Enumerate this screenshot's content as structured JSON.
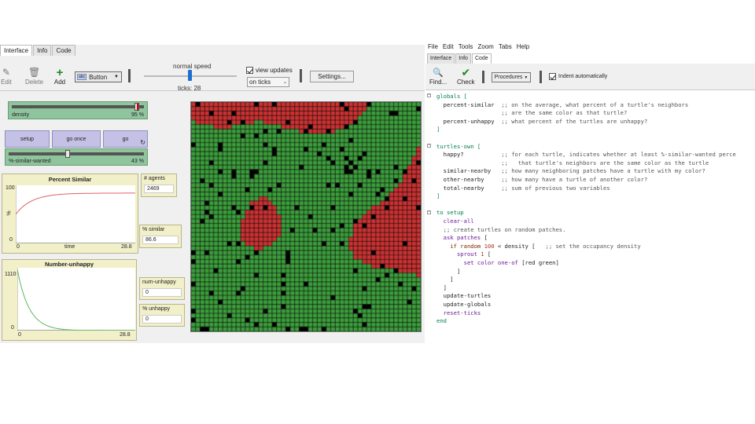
{
  "left": {
    "tabs": [
      {
        "label": "Interface",
        "active": true
      },
      {
        "label": "Info",
        "active": false
      },
      {
        "label": "Code",
        "active": false
      }
    ],
    "toolbar": {
      "edit_label": "Edit",
      "delete_label": "Delete",
      "add_label": "Add",
      "widget_type": "Button",
      "widget_type_icon_text": "abc",
      "speed_label": "normal speed",
      "ticks_label": "ticks: 28",
      "speed_fraction": 0.5,
      "view_updates_label": "view updates",
      "view_updates_checked": true,
      "update_mode": "on ticks",
      "settings_label": "Settings..."
    },
    "widgets": {
      "density": {
        "label": "density",
        "value": "95 %",
        "fraction": 0.95
      },
      "setup_label": "setup",
      "go_once_label": "go once",
      "go_label": "go",
      "similar_wanted": {
        "label": "%-similar-wanted",
        "value": "43 %",
        "fraction": 0.43
      },
      "plot_similar": {
        "title": "Percent Similar",
        "ymax": "100",
        "ymin": "0",
        "xmin": "0",
        "xmax": "28.8",
        "xlabel": "time",
        "ylabel": "%"
      },
      "plot_unhappy": {
        "title": "Number-unhappy",
        "ymax": "1110",
        "ymin": "0",
        "xmin": "0",
        "xmax": "28.8"
      },
      "agents_monitor": {
        "label": "# agents",
        "value": "2469"
      },
      "similar_monitor": {
        "label": "% similar",
        "value": "86.6"
      },
      "num_unhappy_monitor": {
        "label": "num-unhappy",
        "value": "0"
      },
      "pct_unhappy_monitor": {
        "label": "% unhappy",
        "value": "0"
      }
    },
    "colors": {
      "red": "#cd3232",
      "green": "#3c9e3c",
      "empty": "#000000",
      "grid": "#111111",
      "plot_similar_line": "#e06060",
      "plot_unhappy_line": "#5cb85c"
    }
  },
  "right": {
    "menu": [
      "File",
      "Edit",
      "Tools",
      "Zoom",
      "Tabs",
      "Help"
    ],
    "tabs": [
      {
        "label": "Interface",
        "active": false
      },
      {
        "label": "Info",
        "active": false
      },
      {
        "label": "Code",
        "active": true
      }
    ],
    "toolbar": {
      "find_label": "Find...",
      "check_label": "Check",
      "procedures_label": "Procedures",
      "indent_label": "Indent automatically",
      "indent_checked": true
    },
    "code": [
      [
        [
          "kw",
          "globals ["
        ]
      ],
      [
        [
          "plain",
          "  percent-similar  "
        ],
        [
          "cmt",
          ";; on the average, what percent of a turtle's neighbors"
        ]
      ],
      [
        [
          "cmt",
          "                   ;; are the same color as that turtle?"
        ]
      ],
      [
        [
          "plain",
          "  percent-unhappy  "
        ],
        [
          "cmt",
          ";; what percent of the turtles are unhappy?"
        ]
      ],
      [
        [
          "kw",
          "]"
        ]
      ],
      [
        [
          "plain",
          ""
        ]
      ],
      [
        [
          "kw",
          "turtles-own ["
        ]
      ],
      [
        [
          "plain",
          "  happy?           "
        ],
        [
          "cmt",
          ";; for each turtle, indicates whether at least %-similar-wanted perce"
        ]
      ],
      [
        [
          "cmt",
          "                   ;;   that turtle's neighbors are the same color as the turtle"
        ]
      ],
      [
        [
          "plain",
          "  similar-nearby   "
        ],
        [
          "cmt",
          ";; how many neighboring patches have a turtle with my color?"
        ]
      ],
      [
        [
          "plain",
          "  other-nearby     "
        ],
        [
          "cmt",
          ";; how many have a turtle of another color?"
        ]
      ],
      [
        [
          "plain",
          "  total-nearby     "
        ],
        [
          "cmt",
          ";; sum of previous two variables"
        ]
      ],
      [
        [
          "kw",
          "]"
        ]
      ],
      [
        [
          "plain",
          ""
        ]
      ],
      [
        [
          "kw",
          "to setup"
        ]
      ],
      [
        [
          "plain",
          "  "
        ],
        [
          "prim",
          "clear-all"
        ]
      ],
      [
        [
          "plain",
          "  "
        ],
        [
          "cmt",
          ";; create turtles on random patches."
        ]
      ],
      [
        [
          "plain",
          "  "
        ],
        [
          "prim",
          "ask patches"
        ],
        [
          "plain",
          " ["
        ]
      ],
      [
        [
          "plain",
          "    "
        ],
        [
          "rep",
          "if random"
        ],
        [
          "num",
          " 100"
        ],
        [
          "plain",
          " < density [   "
        ],
        [
          "cmt",
          ";; set the occupancy density"
        ]
      ],
      [
        [
          "plain",
          "      "
        ],
        [
          "prim",
          "sprout"
        ],
        [
          "num",
          " 1"
        ],
        [
          "plain",
          " ["
        ]
      ],
      [
        [
          "plain",
          "        "
        ],
        [
          "prim",
          "set color one-of"
        ],
        [
          "plain",
          " [red green]"
        ]
      ],
      [
        [
          "plain",
          "      ]"
        ]
      ],
      [
        [
          "plain",
          "    ]"
        ]
      ],
      [
        [
          "plain",
          "  ]"
        ]
      ],
      [
        [
          "plain",
          "  update-turtles"
        ]
      ],
      [
        [
          "plain",
          "  update-globals"
        ]
      ],
      [
        [
          "plain",
          "  "
        ],
        [
          "prim",
          "reset-ticks"
        ]
      ],
      [
        [
          "kw",
          "end"
        ]
      ]
    ]
  }
}
